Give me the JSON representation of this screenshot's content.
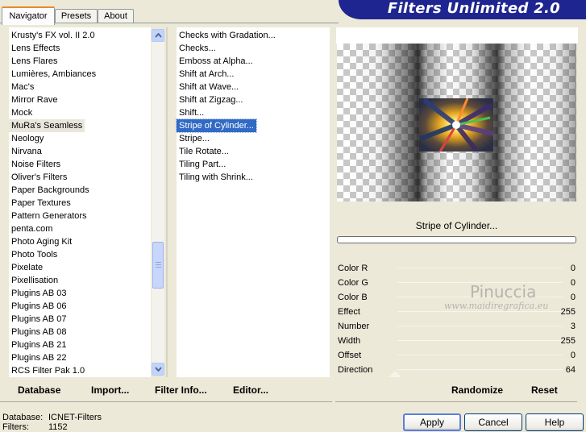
{
  "tabs": [
    {
      "label": "Navigator",
      "active": true
    },
    {
      "label": "Presets",
      "active": false
    },
    {
      "label": "About",
      "active": false
    }
  ],
  "banner": {
    "title": "Filters Unlimited 2.0",
    "color": "#1e2590"
  },
  "categories": {
    "items": [
      "Krusty's FX vol. II 2.0",
      "Lens Effects",
      "Lens Flares",
      "Lumières, Ambiances",
      "Mac's",
      "Mirror Rave",
      "Mock",
      "MuRa's Seamless",
      "Neology",
      "Nirvana",
      "Noise Filters",
      "Oliver's Filters",
      "Paper Backgrounds",
      "Paper Textures",
      "Pattern Generators",
      "penta.com",
      "Photo Aging Kit",
      "Photo Tools",
      "Pixelate",
      "Pixellisation",
      "Plugins AB 03",
      "Plugins AB 06",
      "Plugins AB 07",
      "Plugins AB 08",
      "Plugins AB 21",
      "Plugins AB 22",
      "RCS Filter Pak 1.0"
    ],
    "selected": "MuRa's Seamless"
  },
  "filters": {
    "items": [
      "Checks with Gradation...",
      "Checks...",
      "Emboss at Alpha...",
      "Shift at Arch...",
      "Shift at Wave...",
      "Shift at Zigzag...",
      "Shift...",
      "Stripe of Cylinder...",
      "Stripe...",
      "Tile Rotate...",
      "Tiling Part...",
      "Tiling with Shrink..."
    ],
    "selected": "Stripe of Cylinder..."
  },
  "filter_name": "Stripe of Cylinder...",
  "watermark": {
    "line1": "Pinuccia",
    "line2": "www.maidiregrafica.eu"
  },
  "params": [
    {
      "label": "Color R",
      "value": "0"
    },
    {
      "label": "Color G",
      "value": "0"
    },
    {
      "label": "Color B",
      "value": "0"
    },
    {
      "label": "Effect",
      "value": "255"
    },
    {
      "label": "Number",
      "value": "3"
    },
    {
      "label": "Width",
      "value": "255"
    },
    {
      "label": "Offset",
      "value": "0"
    },
    {
      "label": "Direction",
      "value": "64"
    }
  ],
  "toolbar": {
    "database": "Database",
    "import": "Import...",
    "filter_info": "Filter Info...",
    "editor": "Editor...",
    "randomize": "Randomize",
    "reset": "Reset"
  },
  "status": {
    "database_label": "Database:",
    "database_value": "ICNET-Filters",
    "filters_label": "Filters:",
    "filters_value": "1152"
  },
  "dialog_buttons": {
    "apply": "Apply",
    "cancel": "Cancel",
    "help": "Help"
  }
}
